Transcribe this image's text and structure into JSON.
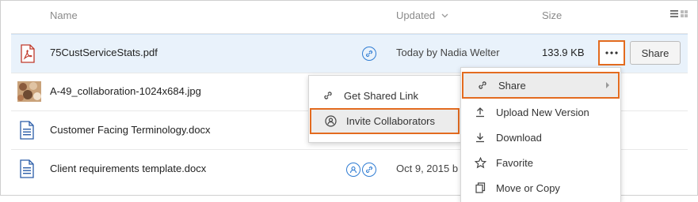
{
  "header": {
    "name_label": "Name",
    "updated_label": "Updated",
    "size_label": "Size"
  },
  "rows": [
    {
      "name": "75CustServiceStats.pdf",
      "updated": "Today by Nadia Welter",
      "size": "133.9 KB",
      "icon": "pdf-file-icon"
    },
    {
      "name": "A-49_collaboration-1024x684.jpg",
      "icon": "image-thumbnail"
    },
    {
      "name": "Customer Facing Terminology.docx",
      "icon": "document-file-icon"
    },
    {
      "name": "Client requirements template.docx",
      "updated": "Oct 9, 2015 b",
      "icon": "document-file-icon"
    }
  ],
  "share_button_label": "Share",
  "submenu": {
    "items": [
      {
        "label": "Get Shared Link",
        "icon": "link-icon"
      },
      {
        "label": "Invite Collaborators",
        "icon": "collaborator-icon"
      }
    ]
  },
  "context_menu": {
    "items": [
      {
        "label": "Share",
        "icon": "link-icon"
      },
      {
        "label": "Upload New Version",
        "icon": "upload-icon"
      },
      {
        "label": "Download",
        "icon": "download-icon"
      },
      {
        "label": "Favorite",
        "icon": "star-icon"
      },
      {
        "label": "Move or Copy",
        "icon": "copy-icon"
      }
    ]
  },
  "colors": {
    "highlight": "#e36b1f",
    "accent": "#2f7cd3",
    "selected_row": "#e9f2fb"
  }
}
